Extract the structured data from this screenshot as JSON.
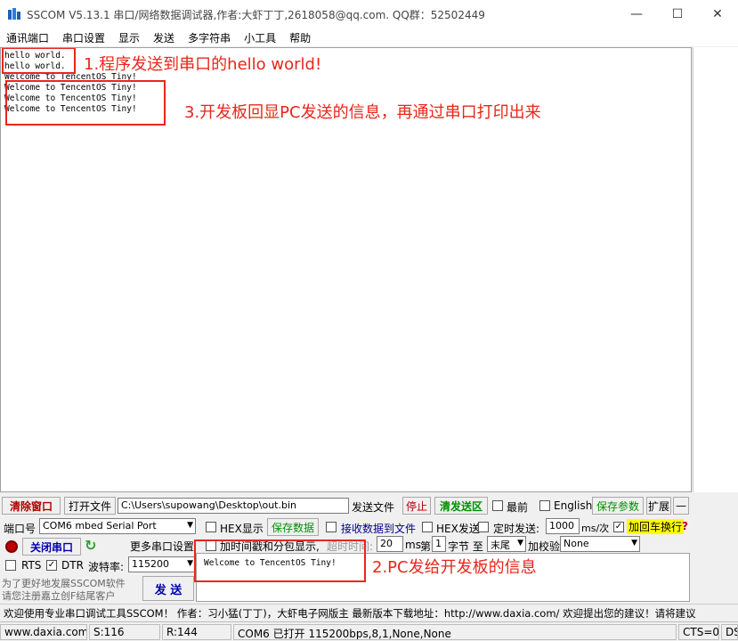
{
  "window": {
    "title": "SSCOM V5.13.1 串口/网络数据调试器,作者:大虾丁丁,2618058@qq.com. QQ群：52502449",
    "minimize_icon": "minimize-icon",
    "maximize_icon": "maximize-icon",
    "close_icon": "close-icon"
  },
  "menu": [
    "通讯端口",
    "串口设置",
    "显示",
    "发送",
    "多字符串",
    "小工具",
    "帮助"
  ],
  "receive": {
    "lines": [
      "hello world.",
      "hello world.",
      "Welcome to TencentOS Tiny!",
      "Welcome to TencentOS Tiny!",
      "Welcome to TencentOS Tiny!",
      "Welcome to TencentOS Tiny!"
    ]
  },
  "annotations": {
    "a1": "1.程序发送到串口的hello world!",
    "a2": "2.PC发给开发板的信息",
    "a3": "3.开发板回显PC发送的信息，再通过串口打印出来"
  },
  "toolbar": {
    "clear_window": "清除窗口",
    "open_file": "打开文件",
    "file_path": "C:\\Users\\supowang\\Desktop\\out.bin",
    "send_file": "发送文件",
    "stop": "停止",
    "clear_send": "清发送区",
    "topmost": "最前",
    "english": "English",
    "save_params": "保存参数",
    "expand": "扩展",
    "collapse": "—"
  },
  "port": {
    "port_label": "端口号",
    "port_value": "COM6 mbed Serial Port",
    "close_port": "关闭串口",
    "more_settings": "更多串口设置",
    "rts": "RTS",
    "dtr": "DTR",
    "baud_label": "波特率:",
    "baud_value": "115200"
  },
  "options": {
    "hex_display": "HEX显示",
    "save_data": "保存数据",
    "recv_to_file": "接收数据到文件",
    "hex_send": "HEX发送",
    "timed_send": "定时发送:",
    "interval": "1000",
    "interval_unit": "ms/次",
    "add_crlf": "加回车换行",
    "timestamp": "加时间戳和分包显示,",
    "timeout_label": "超时时间:",
    "timeout_value": "20",
    "ms": "ms",
    "nth": "第",
    "byte_index": "1",
    "byte_to": "字节 至",
    "end_value": "末尾",
    "checksum_label": "加校验",
    "checksum_value": "None"
  },
  "send": {
    "text": "Welcome to TencentOS Tiny!",
    "send_button": "发 送",
    "promo1": "为了更好地发展SSCOM软件",
    "promo2": "请您注册嘉立创F结尾客户"
  },
  "info_bar": "欢迎使用专业串口调试工具SSCOM！  作者：习小猛(丁丁)，大虾电子网版主  最新版本下载地址：http://www.daxia.com/  欢迎提出您的建议！请将建议",
  "status": {
    "site": "www.daxia.com",
    "sent": "S:116",
    "received": "R:144",
    "port_state": "COM6 已打开  115200bps,8,1,None,None",
    "cts": "CTS=0",
    "dsr": "DS"
  },
  "colors": {
    "annotation": "#e8261b",
    "highlight": "#ffff00"
  }
}
